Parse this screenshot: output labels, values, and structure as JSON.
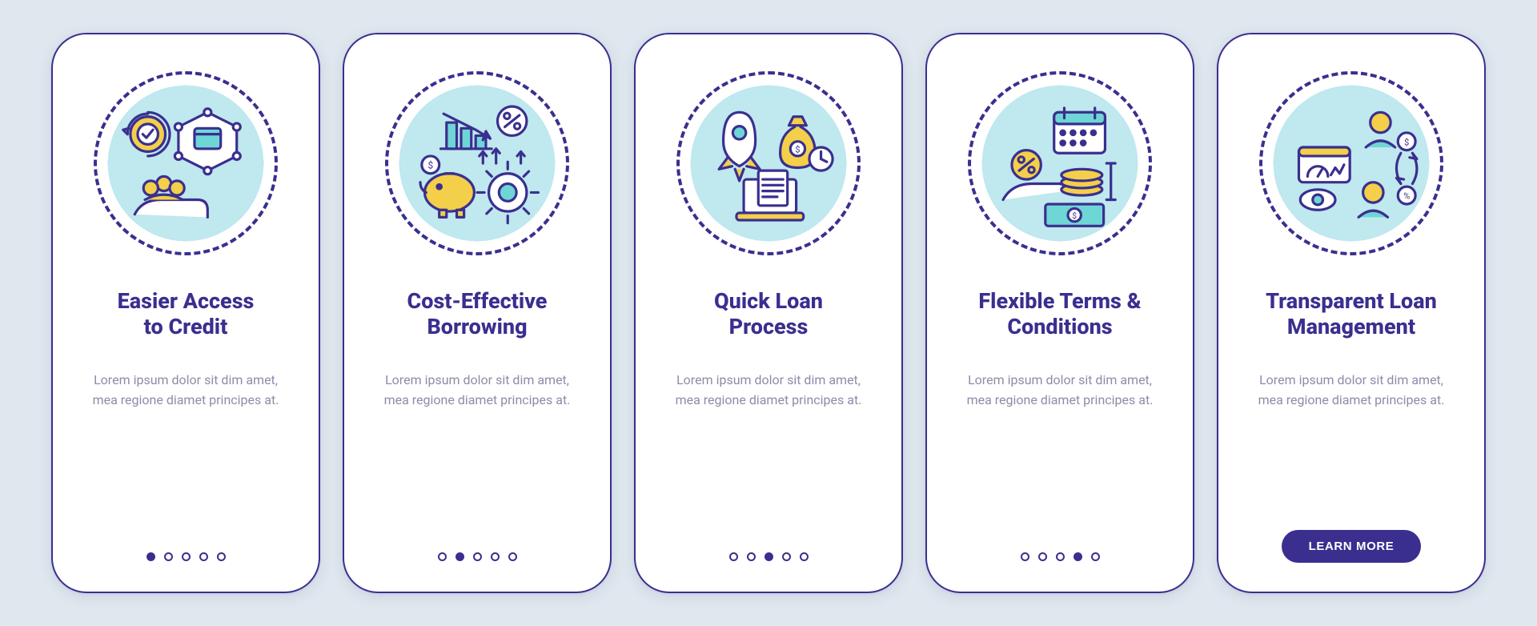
{
  "common": {
    "description": "Lorem ipsum dolor sit dim amet, mea regione diamet principes at.",
    "cta_label": "LEARN MORE",
    "colors": {
      "purple": "#3a2f8f",
      "yellow": "#f3cf4a",
      "teal": "#6FD6D6",
      "light_teal": "#bfe8ef",
      "white": "#ffffff",
      "bg": "#dfe8ee",
      "muted": "#8f8ba8"
    }
  },
  "cards": [
    {
      "title": "Easier Access\nto Credit",
      "icon": "access-credit-icon",
      "active_dot": 0,
      "show_cta": false
    },
    {
      "title": "Cost-Effective\nBorrowing",
      "icon": "cost-effective-icon",
      "active_dot": 1,
      "show_cta": false
    },
    {
      "title": "Quick Loan\nProcess",
      "icon": "quick-loan-icon",
      "active_dot": 2,
      "show_cta": false
    },
    {
      "title": "Flexible Terms &\nConditions",
      "icon": "flexible-terms-icon",
      "active_dot": 3,
      "show_cta": false
    },
    {
      "title": "Transparent Loan\nManagement",
      "icon": "transparent-loan-icon",
      "active_dot": 4,
      "show_cta": true
    }
  ]
}
